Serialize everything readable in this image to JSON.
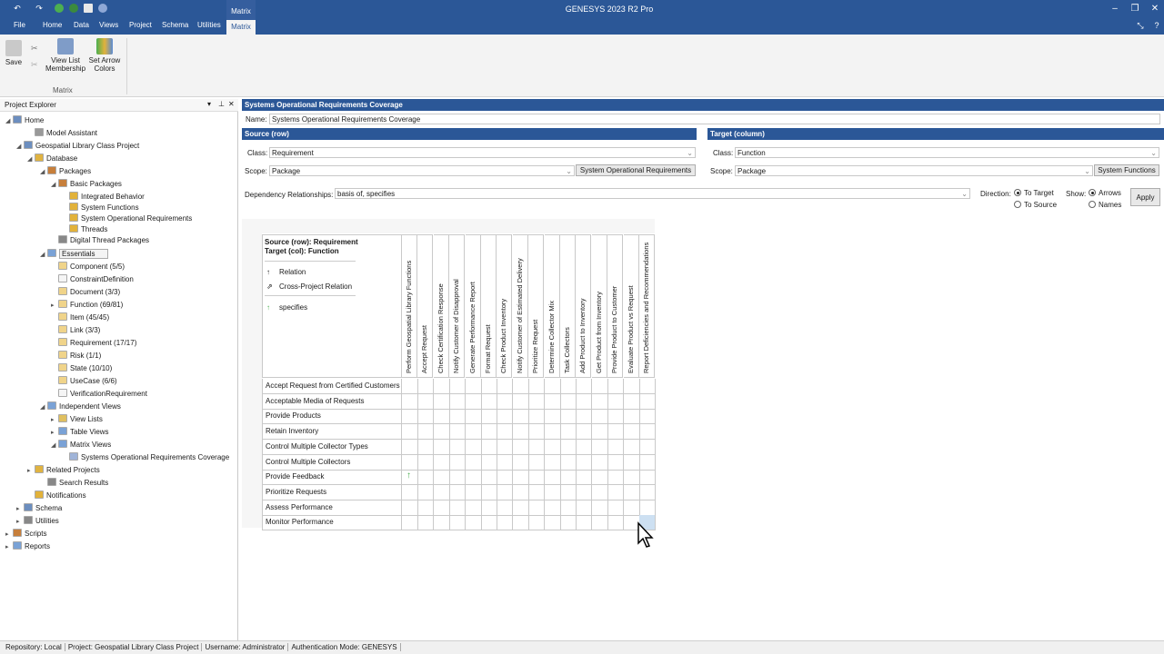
{
  "app": {
    "title": "GENESYS 2023 R2 Pro",
    "context_tab": "Matrix"
  },
  "tabs": [
    "File",
    "Home",
    "Data",
    "Views",
    "Project",
    "Schema",
    "Utilities",
    "Matrix"
  ],
  "ribbon": {
    "save": "Save",
    "view_list": "View List",
    "membership": "Membership",
    "set_arrow": "Set Arrow",
    "colors": "Colors",
    "group": "Matrix"
  },
  "explorer": {
    "title": "Project Explorer",
    "nodes": [
      {
        "label": "Home"
      },
      {
        "label": "Model Assistant"
      },
      {
        "label": "Geospatial Library Class Project"
      },
      {
        "label": "Database"
      },
      {
        "label": "Packages"
      },
      {
        "label": "Basic Packages"
      },
      {
        "label": "Integrated Behavior"
      },
      {
        "label": "System Functions"
      },
      {
        "label": "System Operational Requirements"
      },
      {
        "label": "Threads"
      },
      {
        "label": "Digital Thread Packages"
      },
      {
        "label": "Essentials"
      },
      {
        "label": "Component  (5/5)"
      },
      {
        "label": "ConstraintDefinition"
      },
      {
        "label": "Document  (3/3)"
      },
      {
        "label": "Function  (69/81)"
      },
      {
        "label": "Item  (45/45)"
      },
      {
        "label": "Link  (3/3)"
      },
      {
        "label": "Requirement  (17/17)"
      },
      {
        "label": "Risk  (1/1)"
      },
      {
        "label": "State  (10/10)"
      },
      {
        "label": "UseCase  (6/6)"
      },
      {
        "label": "VerificationRequirement"
      },
      {
        "label": "Independent Views"
      },
      {
        "label": "View Lists"
      },
      {
        "label": "Table Views"
      },
      {
        "label": "Matrix Views"
      },
      {
        "label": "Systems Operational Requirements Coverage"
      },
      {
        "label": "Related Projects"
      },
      {
        "label": "Search Results"
      },
      {
        "label": "Notifications"
      },
      {
        "label": "Schema"
      },
      {
        "label": "Utilities"
      },
      {
        "label": "Scripts"
      },
      {
        "label": "Reports"
      }
    ]
  },
  "matrix": {
    "title": "Systems Operational Requirements Coverage",
    "name_label": "Name:",
    "name_value": "Systems Operational Requirements Coverage",
    "source": {
      "header": "Source (row)",
      "class_label": "Class:",
      "class_value": "Requirement",
      "scope_label": "Scope:",
      "scope_value": "Package",
      "scope_button": "System Operational Requirements"
    },
    "target": {
      "header": "Target (column)",
      "class_label": "Class:",
      "class_value": "Function",
      "scope_label": "Scope:",
      "scope_value": "Package",
      "scope_button": "System Functions"
    },
    "dep_label": "Dependency Relationships:",
    "dep_value": "basis of, specifies",
    "direction_label": "Direction:",
    "to_target": "To Target",
    "to_source": "To Source",
    "show_label": "Show:",
    "arrows": "Arrows",
    "names": "Names",
    "apply": "Apply",
    "legend": {
      "line1": "Source (row): Requirement",
      "line2": "Target (col): Function",
      "relation": "Relation",
      "cross": "Cross-Project Relation",
      "specifies": "specifies"
    },
    "columns": [
      "Perform Geospatial Library Functions",
      "Accept Request",
      "Check Certification Response",
      "Notify Customer of Disapproval",
      "Generate Performance Report",
      "Format Request",
      "Check Product Inventory",
      "Notify Customer of Estimated Delivery",
      "Prioritize Request",
      "Determine Collector Mix",
      "Task Collectors",
      "Add Product to Inventory",
      "Get Product from Inventory",
      "Provide Product to Customer",
      "Evaluate Product vs Request",
      "Report Deficiencies and Recommendations"
    ],
    "rows": [
      "Accept Request from Certified Customers",
      "Acceptable Media of Requests",
      "Provide Products",
      "Retain Inventory",
      "Control Multiple Collector Types",
      "Control Multiple Collectors",
      "Provide Feedback",
      "Prioritize Requests",
      "Assess Performance",
      "Monitor Performance"
    ]
  },
  "status": {
    "repo": "Repository: Local",
    "project": "Project: Geospatial Library Class Project",
    "user": "Username: Administrator",
    "auth": "Authentication Mode: GENESYS"
  }
}
